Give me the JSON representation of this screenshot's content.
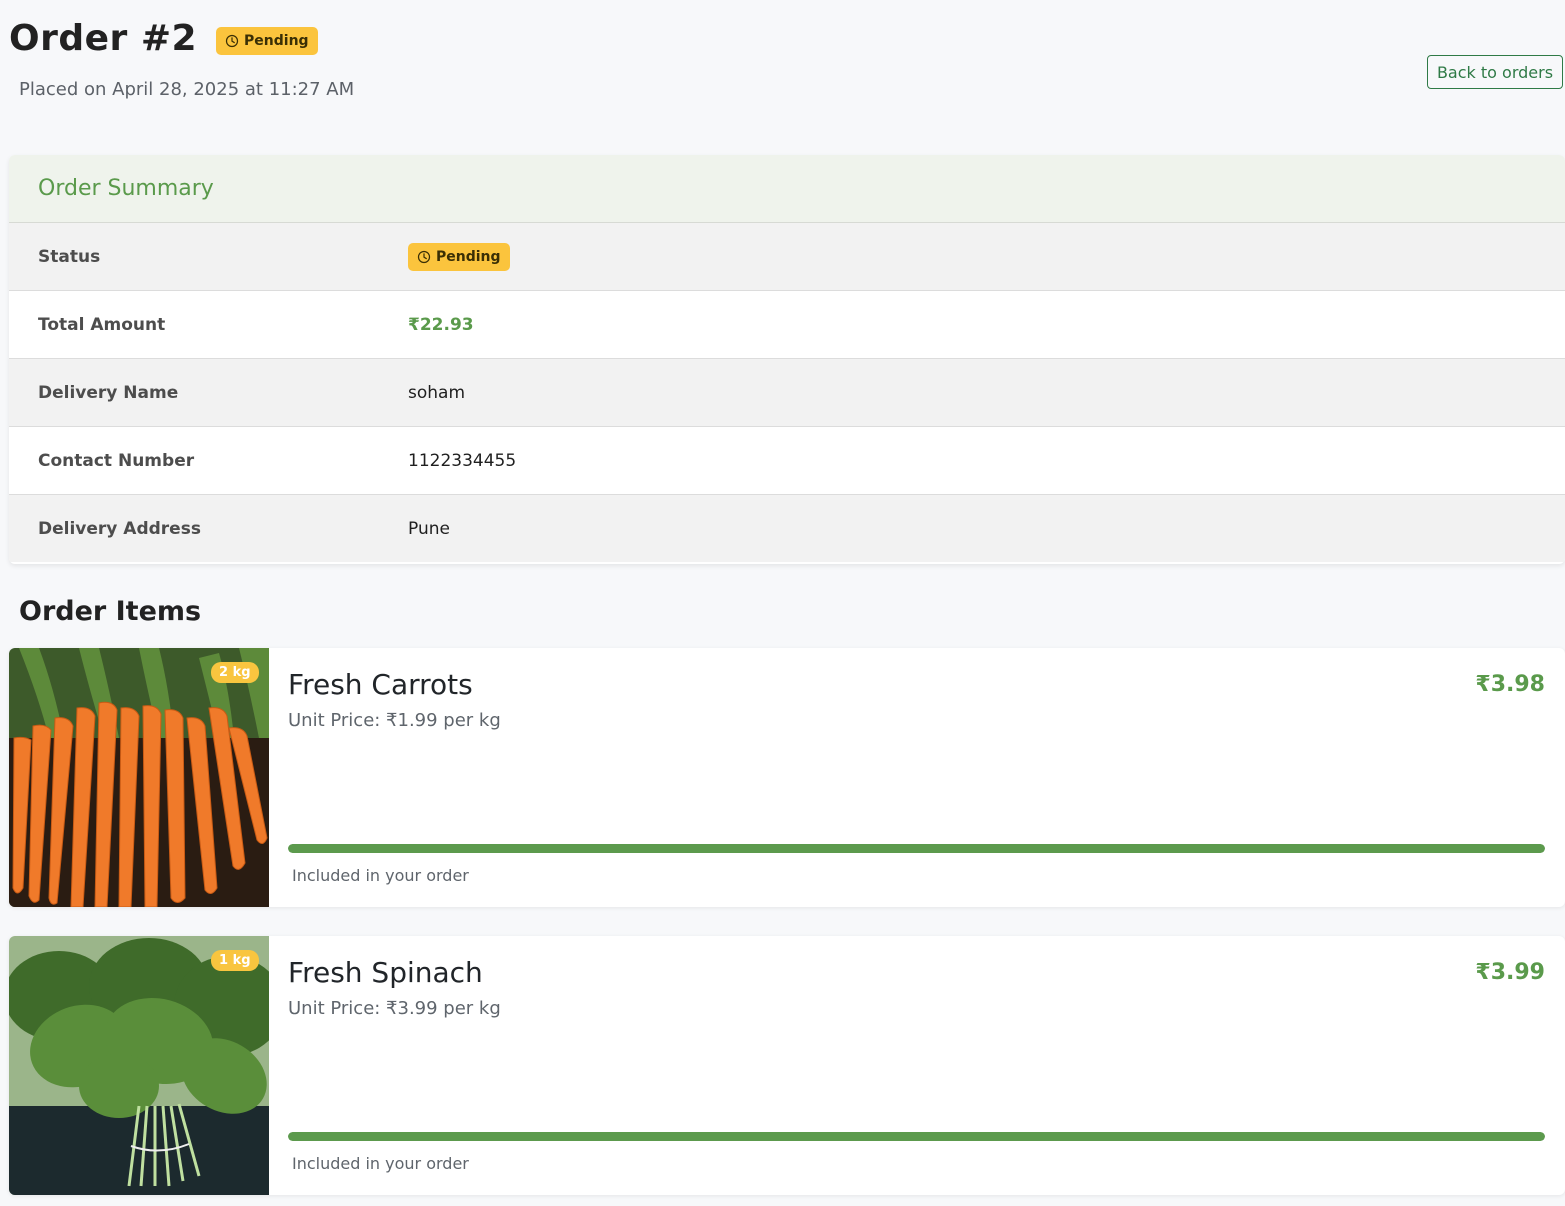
{
  "order": {
    "title": "Order #2",
    "status_badge": "Pending",
    "placed_text": "Placed on April 28, 2025 at 11:27 AM",
    "back_label": "Back to orders"
  },
  "summary": {
    "heading": "Order Summary",
    "rows": [
      {
        "label": "Status",
        "value": "Pending"
      },
      {
        "label": "Total Amount",
        "value": "₹22.93"
      },
      {
        "label": "Delivery Name",
        "value": "soham"
      },
      {
        "label": "Contact Number",
        "value": "1122334455"
      },
      {
        "label": "Delivery Address",
        "value": "Pune"
      }
    ]
  },
  "items_heading": "Order Items",
  "items": [
    {
      "name": "Fresh Carrots",
      "quantity": "2 kg",
      "unit_price": "Unit Price: ₹1.99 per kg",
      "total": "₹3.98",
      "progress": 1.0,
      "progress_label": "Included in your order",
      "image": "carrots-photo"
    },
    {
      "name": "Fresh Spinach",
      "quantity": "1 kg",
      "unit_price": "Unit Price: ₹3.99 per kg",
      "total": "₹3.99",
      "progress": 1.0,
      "progress_label": "Included in your order",
      "image": "spinach-photo"
    }
  ],
  "colors": {
    "accent_green": "#5a9a4b",
    "badge_yellow": "#fbc43d",
    "back_button": "#2f7a46"
  }
}
